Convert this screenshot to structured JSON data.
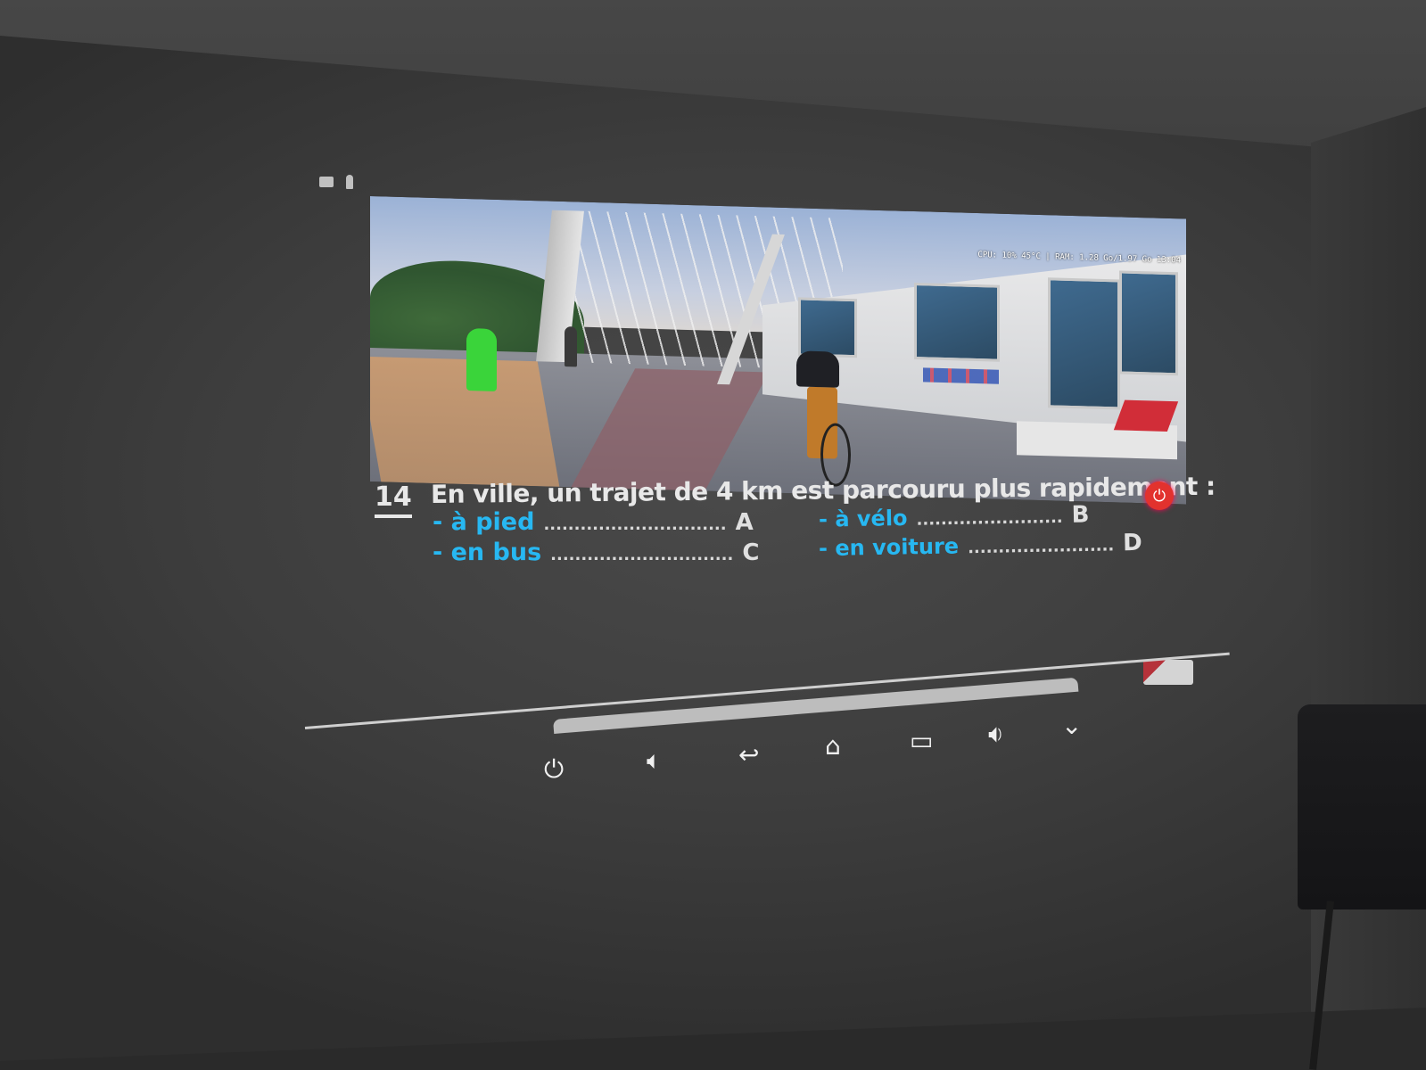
{
  "system_bar": {
    "stats": "CPU: 10% 45°C | RAM: 1.28 Go/1.97 Go  13:04"
  },
  "question": {
    "number": "14",
    "text": "En ville, un trajet de 4 km est parcouru plus rapidement :",
    "answers": [
      {
        "label": "- à pied",
        "letter": "A"
      },
      {
        "label": "- à  vélo",
        "letter": "B"
      },
      {
        "label": "- en bus",
        "letter": "C"
      },
      {
        "label": "- en voiture",
        "letter": "D"
      }
    ],
    "dots_long": "..............................",
    "dots_short": "........................"
  },
  "colors": {
    "answer_text": "#27b8f2",
    "timer": "#e2322e"
  },
  "nav": {
    "icons": [
      "power-icon",
      "volume-down-icon",
      "back-icon",
      "home-icon",
      "recent-apps-icon",
      "volume-up-icon",
      "collapse-icon"
    ]
  }
}
